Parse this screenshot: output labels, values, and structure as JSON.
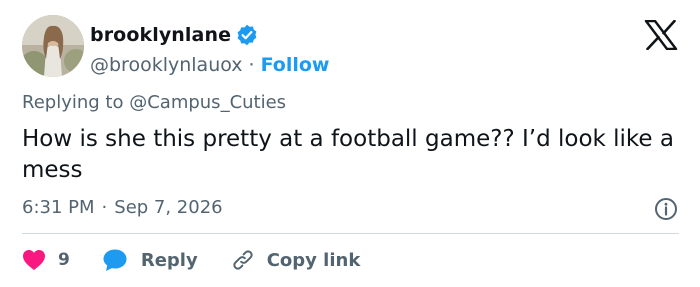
{
  "author": {
    "display_name": "brooklynlane",
    "handle": "@brooklynlauox",
    "separator": "·",
    "follow_label": "Follow",
    "verified": true
  },
  "reply_context": {
    "prefix": "Replying to",
    "mention": "@Campus_Cuties"
  },
  "tweet": {
    "text": "How is she this pretty at a football game?? I’d look like a mess"
  },
  "meta": {
    "time": "6:31 PM",
    "separator": "·",
    "date": "Sep 7, 2026"
  },
  "actions": {
    "like_count": "9",
    "reply_label": "Reply",
    "copy_link_label": "Copy link"
  },
  "icons": {
    "brand": "x-logo-icon",
    "verified": "verified-badge-icon",
    "info": "info-icon",
    "like": "heart-icon",
    "reply": "speech-bubble-icon",
    "copy": "link-icon"
  },
  "colors": {
    "accent": "#1d9bf0",
    "heart": "#f91880",
    "text_primary": "#0f1419",
    "text_secondary": "#536471",
    "divider": "#cfd9de"
  }
}
